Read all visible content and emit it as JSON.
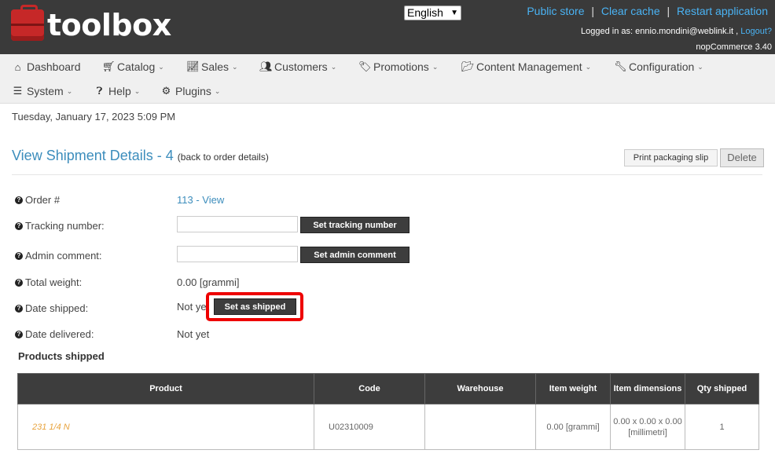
{
  "header": {
    "logo_text": "toolbox",
    "language": "English",
    "links": {
      "public_store": "Public store",
      "clear_cache": "Clear cache",
      "restart": "Restart application",
      "sep": "|"
    },
    "logged_in_label": "Logged in as: ennio.mondini@weblink.it ,",
    "logout": "Logout?",
    "version": "nopCommerce 3.40"
  },
  "nav": {
    "dashboard": "Dashboard",
    "catalog": "Catalog",
    "sales": "Sales",
    "customers": "Customers",
    "promotions": "Promotions",
    "content_management": "Content Management",
    "configuration": "Configuration",
    "system": "System",
    "help": "Help",
    "plugins": "Plugins"
  },
  "date_line": "Tuesday, January 17, 2023 5:09 PM",
  "page": {
    "title": "View Shipment Details - 4",
    "back_link": "(back to order details)",
    "print_button": "Print packaging slip",
    "delete_button": "Delete"
  },
  "fields": {
    "order_label": "Order #",
    "order_value": "113 - View",
    "tracking_label": "Tracking number:",
    "tracking_value": "",
    "tracking_button": "Set tracking number",
    "admin_comment_label": "Admin comment:",
    "admin_comment_value": "",
    "admin_comment_button": "Set admin comment",
    "total_weight_label": "Total weight:",
    "total_weight_value": "0.00 [grammi]",
    "date_shipped_label": "Date shipped:",
    "date_shipped_value": "Not yet",
    "set_shipped_button": "Set as shipped",
    "date_delivered_label": "Date delivered:",
    "date_delivered_value": "Not yet"
  },
  "products": {
    "title": "Products shipped",
    "headers": {
      "product": "Product",
      "code": "Code",
      "warehouse": "Warehouse",
      "item_weight": "Item weight",
      "item_dimensions": "Item dimensions",
      "qty_shipped": "Qty shipped"
    },
    "rows": [
      {
        "product": "231 1/4 N",
        "code": "U02310009",
        "warehouse": "",
        "item_weight": "0.00 [grammi]",
        "item_dimensions": "0.00 x 0.00 x 0.00 [millimetri]",
        "qty_shipped": "1"
      }
    ]
  },
  "colors": {
    "header_bg": "#3a3a3a",
    "link_blue": "#4ab3f4",
    "title_blue": "#3c8dbc",
    "highlight_red": "#ee0000",
    "product_orange": "#e8a33d"
  }
}
